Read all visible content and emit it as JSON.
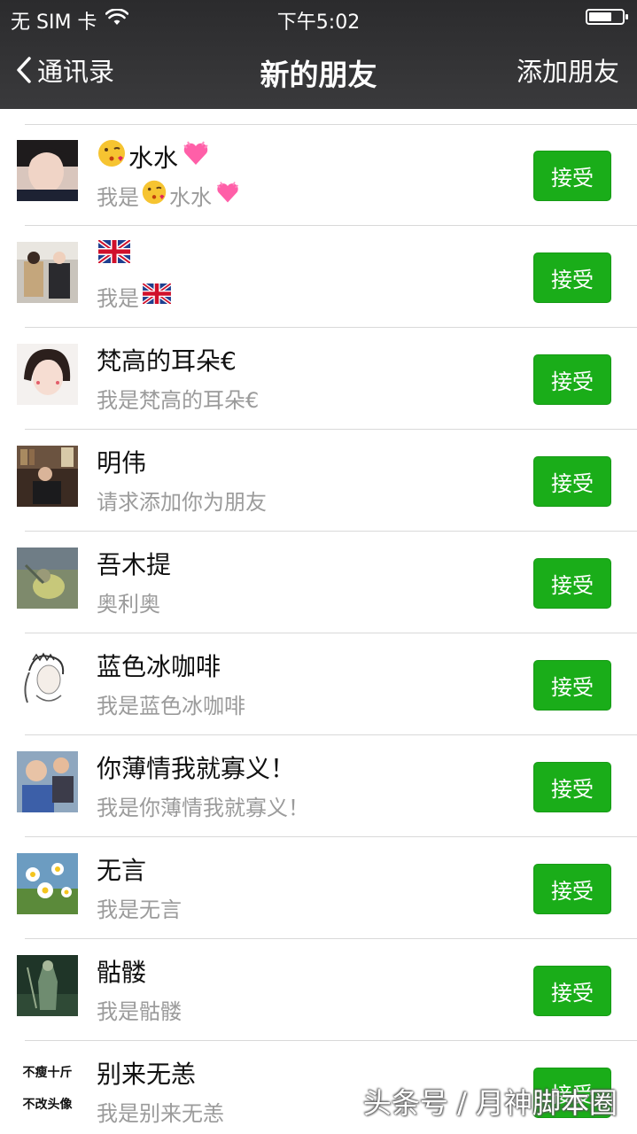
{
  "status_bar": {
    "carrier": "无 SIM 卡",
    "time": "下午5:02"
  },
  "nav": {
    "back_label": "通讯录",
    "title": "新的朋友",
    "add_label": "添加朋友"
  },
  "accept_label": "接受",
  "requests": [
    {
      "name": "水水",
      "message_prefix": "我是",
      "message": "水水",
      "icons": [
        "kiss-emoji-icon",
        "heart-emoji-icon"
      ]
    },
    {
      "name": "",
      "message_prefix": "我是",
      "message": "",
      "icons": [
        "uk-flag-icon"
      ]
    },
    {
      "name": "梵高的耳朵€",
      "message": "我是梵高的耳朵€"
    },
    {
      "name": "明伟",
      "message": "请求添加你为朋友"
    },
    {
      "name": "吾木提",
      "message": "奥利奥"
    },
    {
      "name": "蓝色冰咖啡",
      "message": "我是蓝色冰咖啡"
    },
    {
      "name": "你薄情我就寡义！",
      "message": "我是你薄情我就寡义！"
    },
    {
      "name": "无言",
      "message": "我是无言"
    },
    {
      "name": "骷髅",
      "message": "我是骷髅"
    },
    {
      "name": "别来无恙",
      "message": "我是别来无恙",
      "avatar_text": [
        "不瘦十斤",
        "不改头像"
      ]
    }
  ],
  "watermark": "头条号 / 月神脚本圈",
  "colors": {
    "accent": "#1aad19",
    "nav_bg": "#2b2b2d",
    "secondary_text": "#9b9b9b"
  }
}
